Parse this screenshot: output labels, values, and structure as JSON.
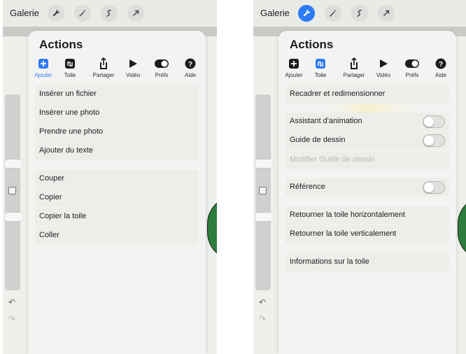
{
  "left": {
    "topbar": {
      "gallery": "Galerie",
      "active_tool": "wrench-icon"
    },
    "panel": {
      "title": "Actions",
      "tabs": [
        {
          "label": "Ajouter",
          "icon": "add-icon",
          "active": true
        },
        {
          "label": "Toile",
          "icon": "canvas-icon",
          "active": false
        },
        {
          "label": "Partager",
          "icon": "share-icon",
          "active": false
        },
        {
          "label": "Vidéo",
          "icon": "play-icon",
          "active": false
        },
        {
          "label": "Préfs",
          "icon": "toggle-icon",
          "active": false
        },
        {
          "label": "Aide",
          "icon": "help-icon",
          "active": false
        }
      ],
      "items": [
        "Insérer un fichier",
        "Insérer une photo",
        "Prendre une photo",
        "Ajouter du texte",
        "Couper",
        "Copier",
        "Copier la toile",
        "Coller"
      ]
    }
  },
  "right": {
    "topbar": {
      "gallery": "Galerie",
      "active_tool": "wrench-icon"
    },
    "panel": {
      "title": "Actions",
      "tabs": [
        {
          "label": "Ajouter",
          "icon": "add-icon",
          "active": false
        },
        {
          "label": "Toile",
          "icon": "canvas-icon",
          "active": true
        },
        {
          "label": "Partager",
          "icon": "share-icon",
          "active": false
        },
        {
          "label": "Vidéo",
          "icon": "play-icon",
          "active": false
        },
        {
          "label": "Préfs",
          "icon": "toggle-icon",
          "active": false
        },
        {
          "label": "Aide",
          "icon": "help-icon",
          "active": false
        }
      ],
      "items": {
        "resize": "Recadrer et redimensionner",
        "animation_assist": "Assistant d'animation",
        "drawing_guide": "Guide de dessin",
        "edit_drawing_guide": "Modifier Guide de dessin",
        "reference": "Référence",
        "flip_horizontal": "Retourner la toile horizontalement",
        "flip_vertical": "Retourner la toile verticalement",
        "canvas_info": "Informations sur la toile"
      },
      "toggles": {
        "animation_assist": false,
        "drawing_guide": false,
        "reference": false
      }
    }
  },
  "colors": {
    "accent": "#2f7bf5",
    "canvas_green": "#2e7d3e"
  }
}
